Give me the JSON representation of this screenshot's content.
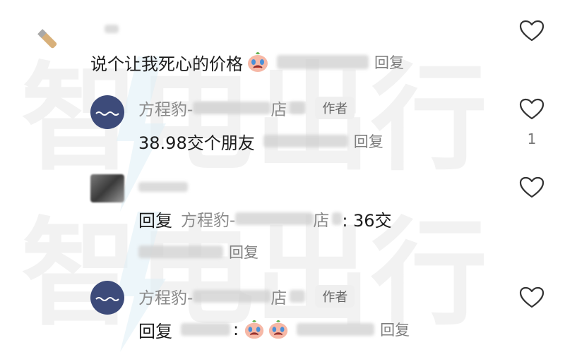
{
  "comment_thread": {
    "top_comment": {
      "text": "说个让我死心的价格",
      "reply_label": "回复"
    },
    "replies": [
      {
        "author_name": "方程豹-",
        "author_store_suffix": "店",
        "author_tag": "作者",
        "text": "38.98交个朋友",
        "reply_label": "回复",
        "like_count": "1"
      },
      {
        "reply_prefix": "回复",
        "quoted_name": "方程豹-",
        "quoted_store_suffix": "店",
        "text": ": 36交",
        "reply_label": "回复"
      },
      {
        "author_name": "方程豹-",
        "author_store_suffix": "店",
        "author_tag": "作者",
        "reply_prefix": "回复",
        "colon": ":",
        "reply_label": "回复"
      }
    ],
    "icons": {
      "like": "heart-outline-icon",
      "emoji": "crying-face-emoji"
    }
  },
  "watermark": {
    "text": "智电出行",
    "color": "#e6e6e6"
  }
}
